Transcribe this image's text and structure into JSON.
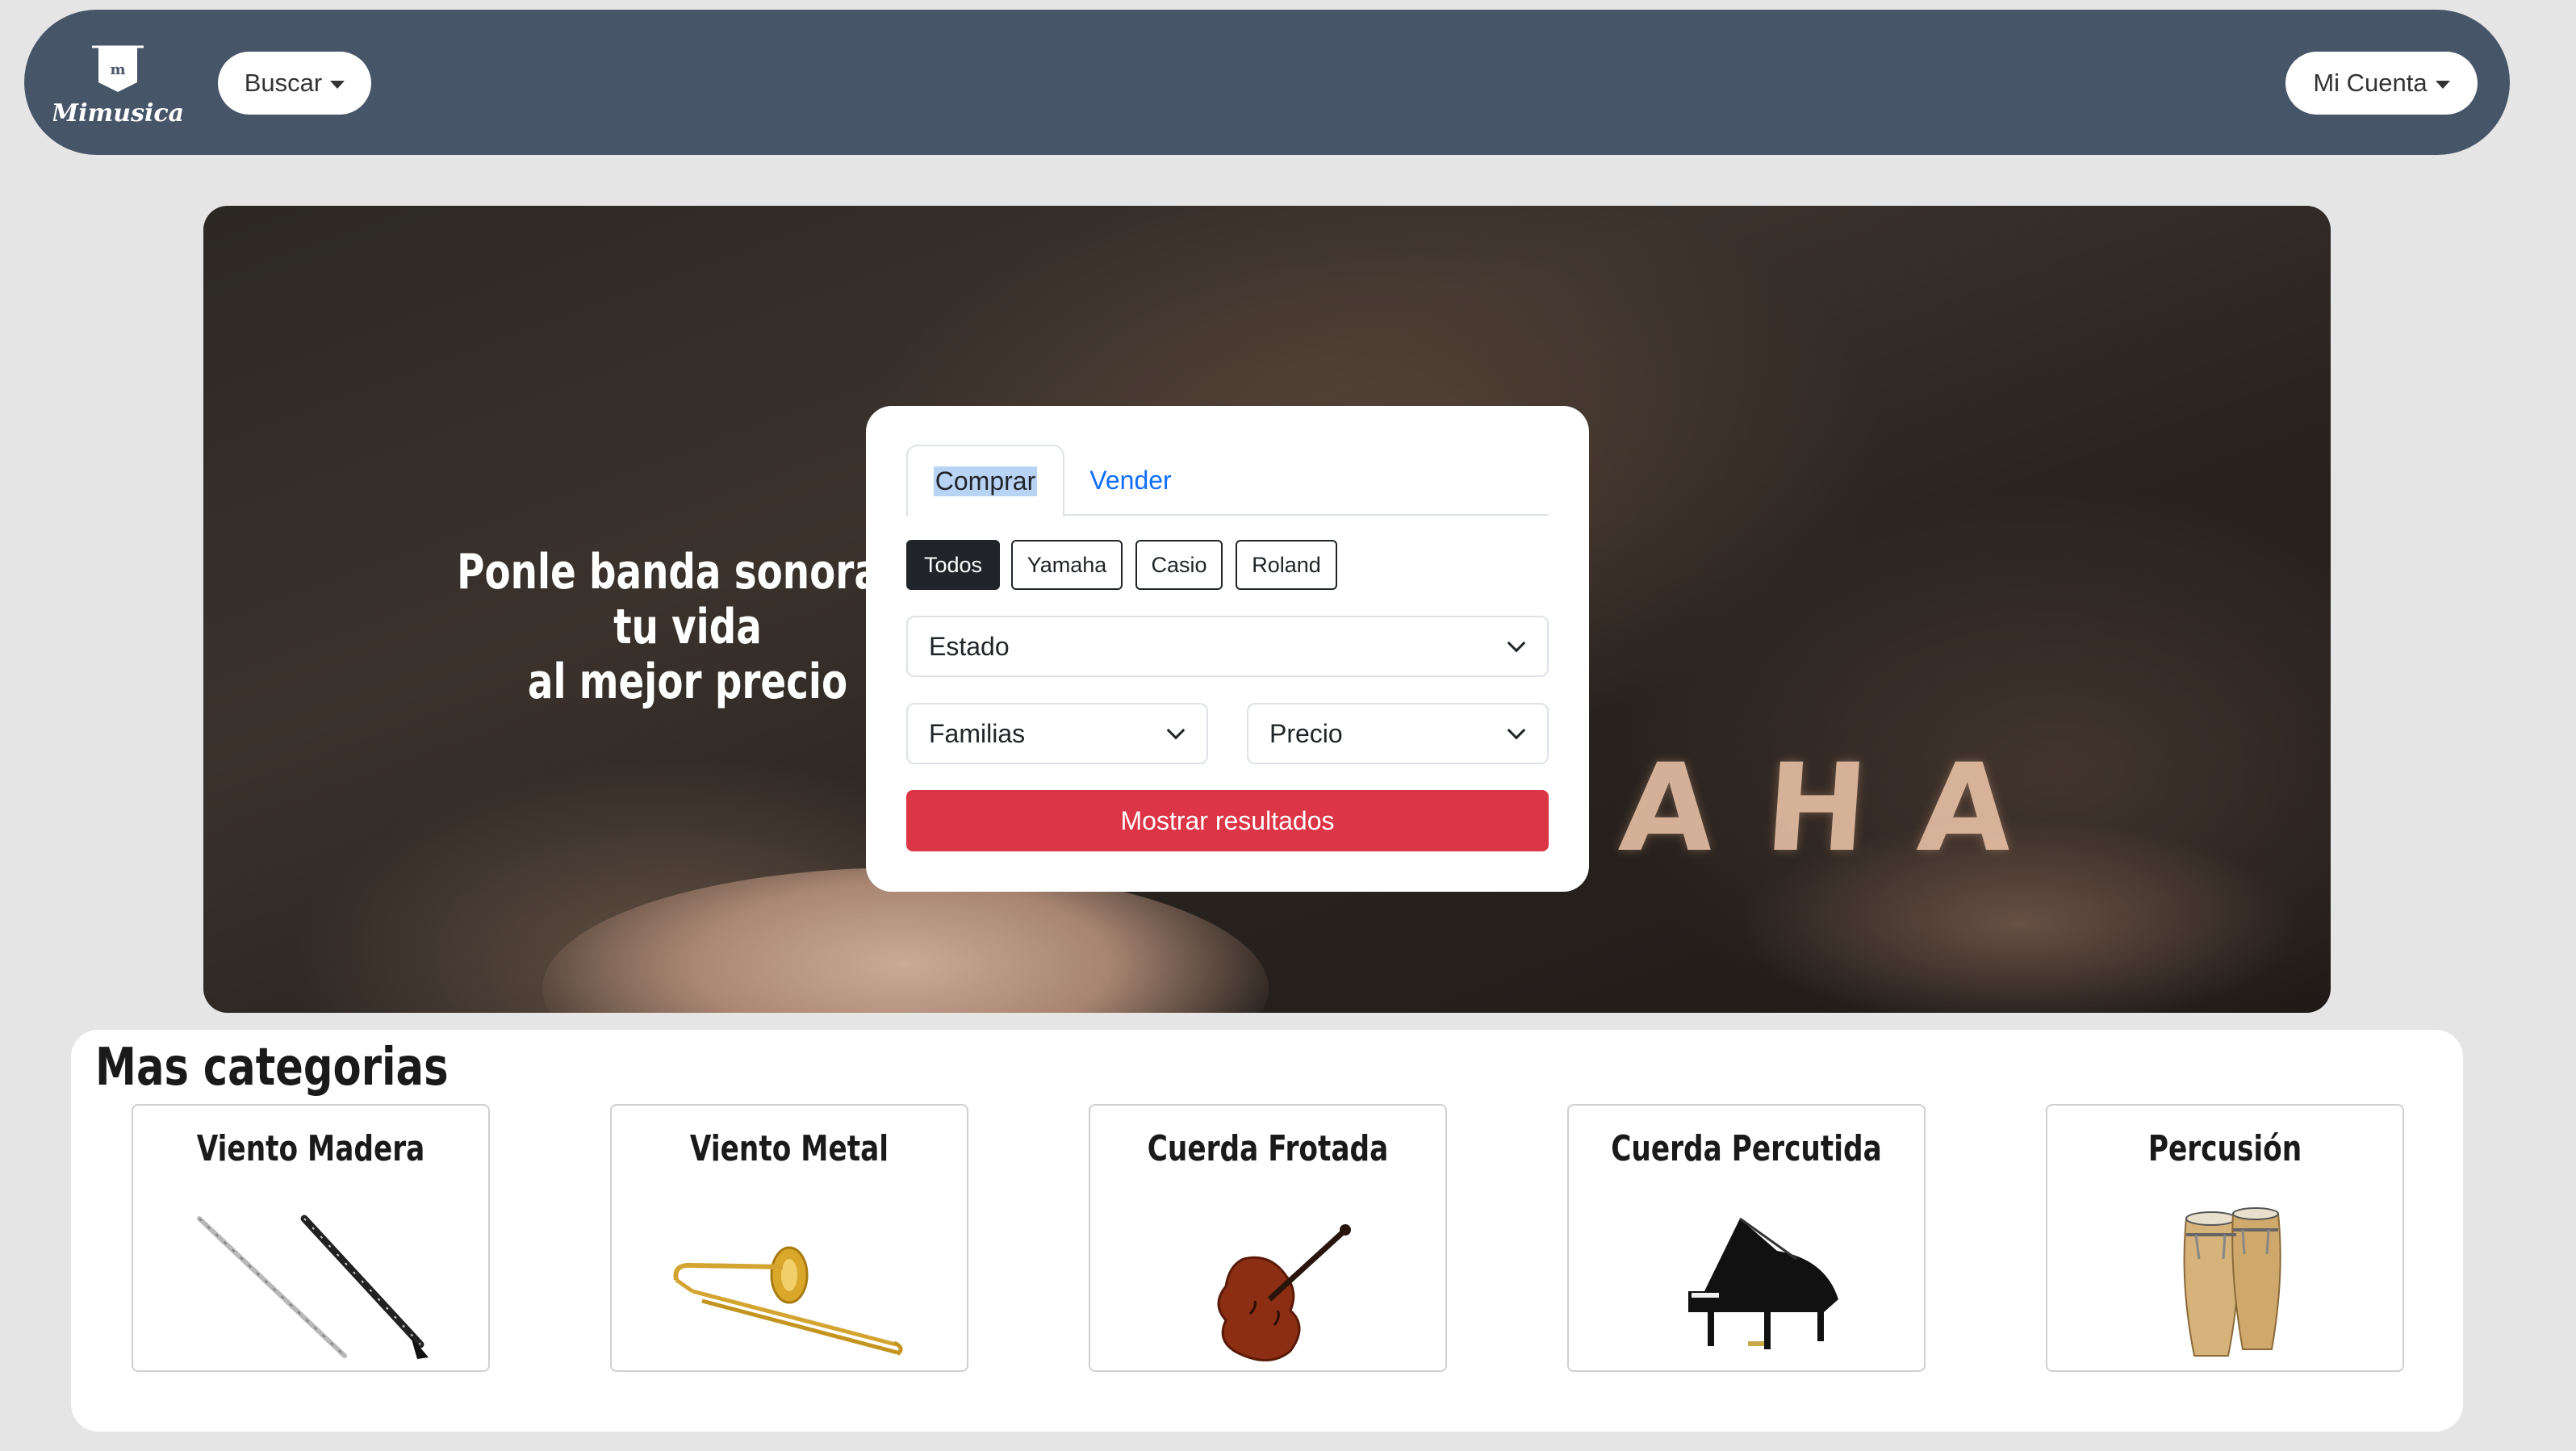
{
  "navbar": {
    "logo_text": "Mimusica",
    "search_label": "Buscar",
    "account_label": "Mi Cuenta"
  },
  "hero": {
    "tagline_line1": "Ponle banda sonora a tu vida",
    "tagline_line2": "al mejor precio",
    "background_brand_text": "AHA"
  },
  "search": {
    "tabs": [
      {
        "label": "Comprar",
        "active": true
      },
      {
        "label": "Vender",
        "active": false
      }
    ],
    "brands": [
      {
        "label": "Todos",
        "active": true
      },
      {
        "label": "Yamaha",
        "active": false
      },
      {
        "label": "Casio",
        "active": false
      },
      {
        "label": "Roland",
        "active": false
      }
    ],
    "estado_select": "Estado",
    "familias_select": "Familias",
    "precio_select": "Precio",
    "submit_label": "Mostrar resultados"
  },
  "categories": {
    "title": "Mas categorias",
    "items": [
      {
        "name": "Viento Madera",
        "icon": "flute-clarinet-image"
      },
      {
        "name": "Viento Metal",
        "icon": "trombone-image"
      },
      {
        "name": "Cuerda Frotada",
        "icon": "cello-image"
      },
      {
        "name": "Cuerda Percutida",
        "icon": "grand-piano-image"
      },
      {
        "name": "Percusión",
        "icon": "conga-drums-image"
      }
    ]
  },
  "colors": {
    "navbar": "#475569",
    "accent_red": "#dc3545",
    "link_blue": "#0d6efd",
    "page_bg": "#e5e5e5"
  }
}
